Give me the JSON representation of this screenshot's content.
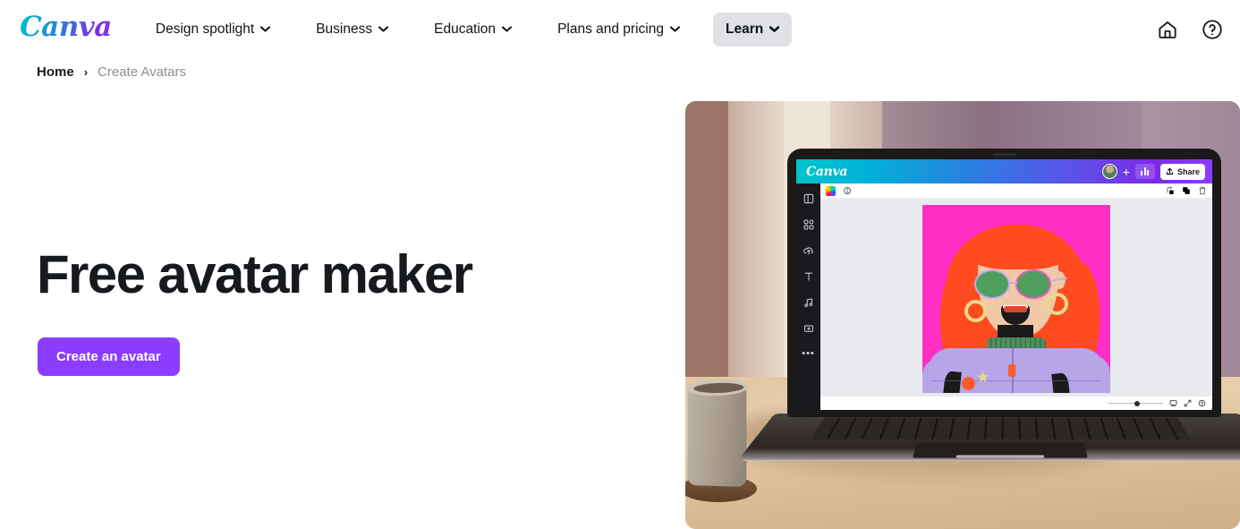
{
  "brand": {
    "logo_text": "Canva",
    "logo_gradient_from": "#00c4cc",
    "logo_gradient_to": "#8b3dff"
  },
  "nav": {
    "items": [
      {
        "label": "Design spotlight",
        "has_dropdown": true,
        "active": false
      },
      {
        "label": "Business",
        "has_dropdown": true,
        "active": false
      },
      {
        "label": "Education",
        "has_dropdown": true,
        "active": false
      },
      {
        "label": "Plans and pricing",
        "has_dropdown": true,
        "active": false
      },
      {
        "label": "Learn",
        "has_dropdown": true,
        "active": true
      }
    ],
    "right_icons": [
      {
        "name": "home-icon"
      },
      {
        "name": "help-circle-icon"
      }
    ],
    "active_pill_color": "#dfe1e6"
  },
  "breadcrumb": {
    "home": "Home",
    "separator": "›",
    "current": "Create Avatars"
  },
  "hero": {
    "title": "Free avatar maker",
    "cta_label": "Create an avatar",
    "cta_color": "#8b3dff",
    "title_color": "#16191d"
  },
  "hero_image": {
    "scene": "laptop-on-wood-desk-with-plant-pot",
    "editor": {
      "logo_text": "Canva",
      "share_label": "Share",
      "topbar_gradient_from": "#00c4cc",
      "topbar_gradient_to": "#8b3dff",
      "topbar_icons": [
        "user-avatar",
        "add-member-plus-icon",
        "bar-chart-icon",
        "upload-share-icon"
      ],
      "sidebar_icons": [
        "design-panel-icon",
        "elements-grid-icon",
        "upload-cloud-icon",
        "text-icon",
        "audio-note-icon",
        "video-box-icon",
        "more-dots-icon"
      ],
      "toolbar_icons": [
        "color-swatch-icon",
        "transparency-icon",
        "position-icon",
        "duplicate-icon",
        "trash-icon"
      ],
      "bottombar_icons": [
        "zoom-slider",
        "present-screen-icon",
        "fullscreen-expand-icon",
        "help-circle-icon"
      ],
      "canvas": {
        "background_color": "#ff2ec4",
        "subject": "illustrated-woman-avatar",
        "hair_color": "#ff4b1f",
        "skin_color": "#f2c9a8",
        "glasses_frame_color": "#c9a7e8",
        "lens_color": "#4f9e5e",
        "earring_color": "#ead98a",
        "collar_color": "#4f8f5e",
        "jacket_color": "#b6a6e8",
        "badge_dot_color": "#ff5a2b"
      }
    }
  }
}
